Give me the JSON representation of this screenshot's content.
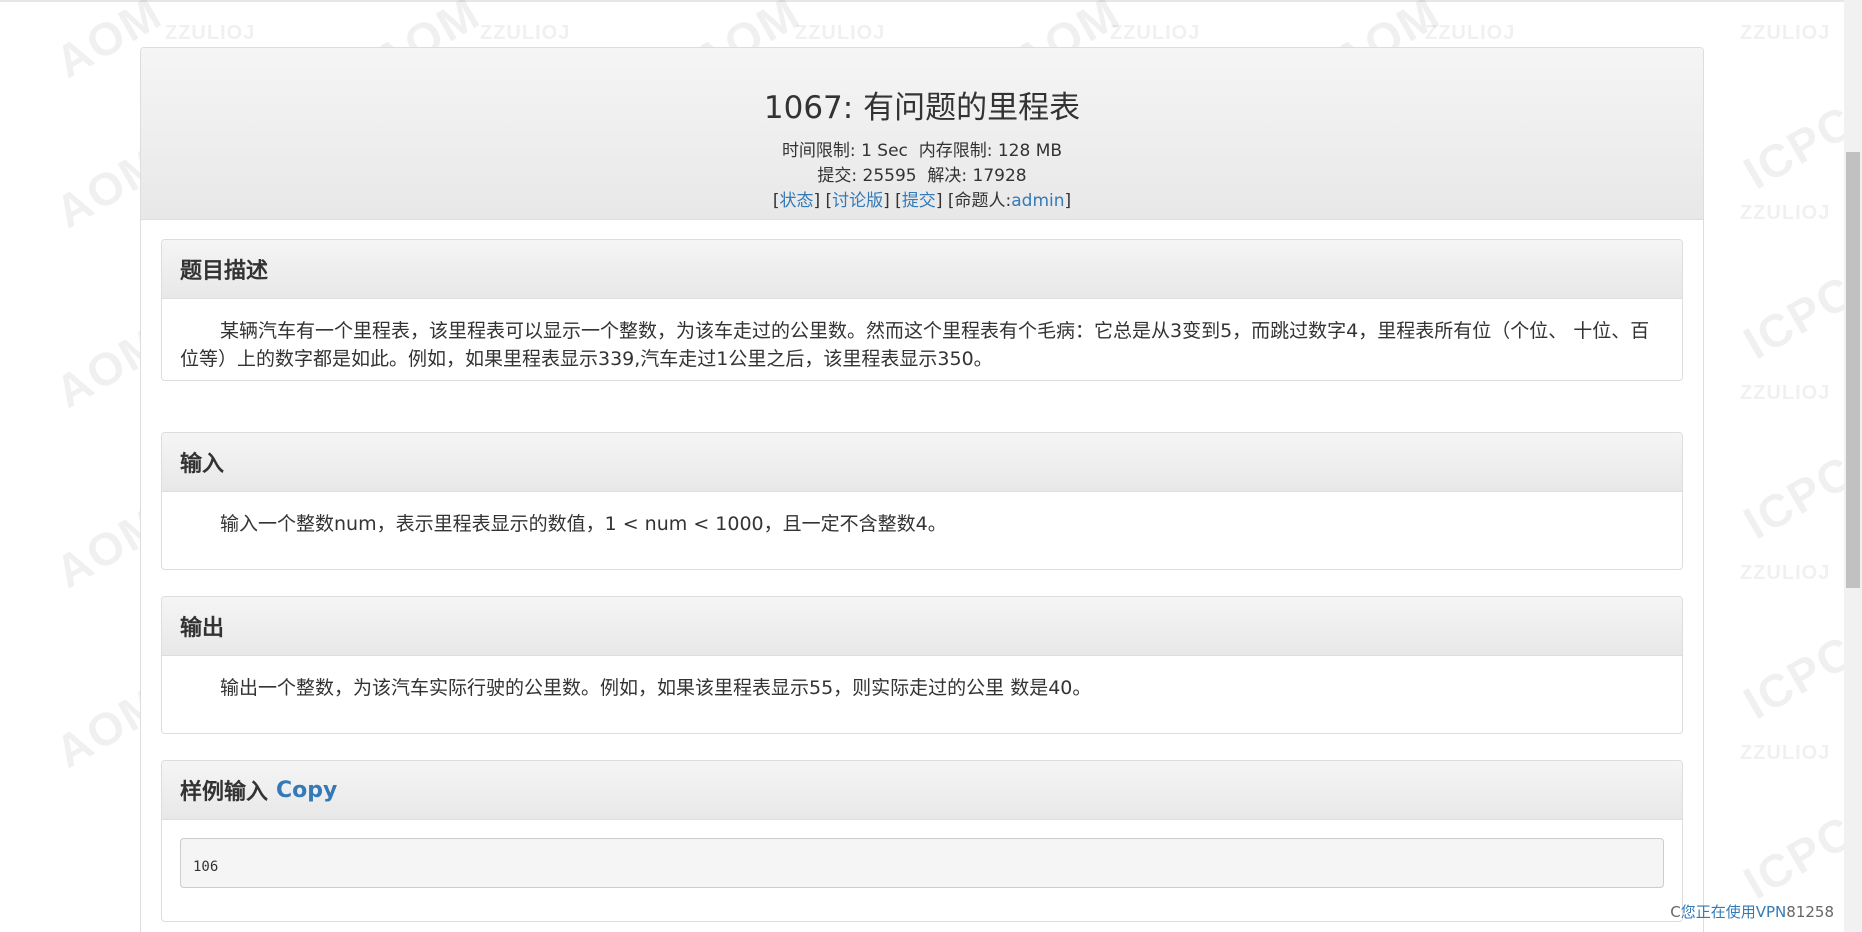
{
  "watermark": {
    "brand_big_1": "AOM",
    "brand_big_2": "ICPC",
    "brand_small": "ZZULIOJ"
  },
  "problem": {
    "title": "1067: 有问题的里程表",
    "time_limit_label": "时间限制:",
    "time_limit_value": "1 Sec",
    "memory_limit_label": "内存限制:",
    "memory_limit_value": "128 MB",
    "submit_label": "提交:",
    "submit_count": "25595",
    "solved_label": "解决:",
    "solved_count": "17928",
    "links": {
      "status": "状态",
      "discuss": "讨论版",
      "submit": "提交",
      "author_label": "[命题人:",
      "author_name": "admin"
    }
  },
  "sections": {
    "description": {
      "heading": "题目描述",
      "text": "某辆汽车有一个里程表，该里程表可以显示一个整数，为该车走过的公里数。然而这个里程表有个毛病：它总是从3变到5，而跳过数字4，里程表所有位（个位、 十位、百位等）上的数字都是如此。例如，如果里程表显示339,汽车走过1公里之后，该里程表显示350。"
    },
    "input": {
      "heading": "输入",
      "text": "输入一个整数num，表示里程表显示的数值，1 < num < 1000，且一定不含整数4。"
    },
    "output": {
      "heading": "输出",
      "text": "输出一个整数，为该汽车实际行驶的公里数。例如，如果该里程表显示55，则实际走过的公里 数是40。"
    },
    "sample_input": {
      "heading": "样例输入",
      "copy_label": "Copy",
      "data": "106"
    }
  },
  "corner": {
    "prefix": "C",
    "vpn_notice": "您正在使用VPN",
    "suffix": "81258"
  }
}
